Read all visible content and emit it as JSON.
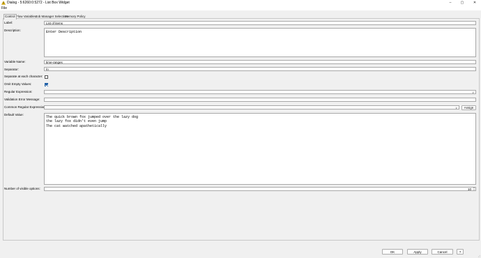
{
  "window": {
    "title": "Dialog - 5:6260:0:5272 - List Box Widget",
    "minimize_glyph": "–",
    "maximize_glyph": "▢",
    "close_glyph": "✕",
    "icon": "warning-triangle-icon"
  },
  "menu": {
    "file": "File"
  },
  "tabs": [
    {
      "label": "Control",
      "active": true
    },
    {
      "label": "Flow Variables",
      "active": false
    },
    {
      "label": "Job Manager Selection",
      "active": false
    },
    {
      "label": "Memory Policy",
      "active": false
    }
  ],
  "form": {
    "label": {
      "label": "Label:",
      "value": "List of items"
    },
    "description": {
      "label": "Description:",
      "value": "Enter Description"
    },
    "variable_name": {
      "label": "Variable Name:",
      "value": "time-ranges"
    },
    "separator": {
      "label": "Separator:",
      "value": "\\n"
    },
    "separate_each_char": {
      "label": "Separate at each character:",
      "checked": false
    },
    "omit_empty": {
      "label": "Omit Empty Values:",
      "checked": true
    },
    "regex": {
      "label": "Regular Expression:",
      "value": ""
    },
    "validation_error": {
      "label": "Validation Error Message:",
      "value": ""
    },
    "common_regex": {
      "label": "Common Regular Expressions:",
      "value": "",
      "assign": "Assign"
    },
    "default_value": {
      "label": "Default Value:",
      "value": "The quick brown fox jumped over the lazy dog\nthe lazy fox didn't even jump\nThe cat watched apathetically"
    },
    "visible_options": {
      "label": "Number of visible options:",
      "value": "10"
    }
  },
  "buttons": {
    "ok": "OK",
    "apply": "Apply",
    "cancel": "Cancel",
    "help": "?"
  },
  "colors": {
    "accent": "#1f5fa6",
    "warning": "#f2c200"
  }
}
